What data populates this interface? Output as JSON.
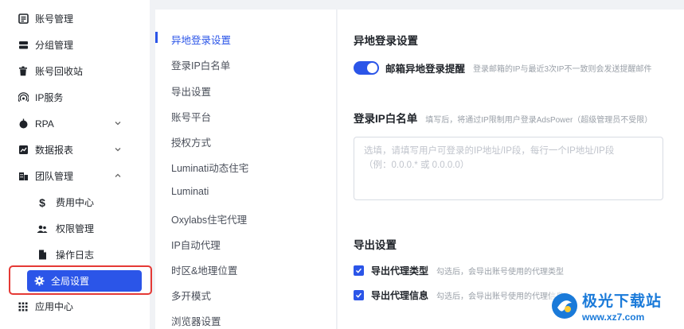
{
  "sidebar": {
    "items": [
      {
        "label": "账号管理",
        "icon": "account-list-icon"
      },
      {
        "label": "分组管理",
        "icon": "group-icon"
      },
      {
        "label": "账号回收站",
        "icon": "trash-icon"
      },
      {
        "label": "IP服务",
        "icon": "signal-icon"
      },
      {
        "label": "RPA",
        "icon": "robot-icon"
      },
      {
        "label": "数据报表",
        "icon": "chart-icon"
      },
      {
        "label": "团队管理",
        "icon": "team-icon"
      },
      {
        "label": "费用中心",
        "icon": "dollar-icon"
      },
      {
        "label": "权限管理",
        "icon": "users-icon"
      },
      {
        "label": "操作日志",
        "icon": "document-icon"
      },
      {
        "label": "全局设置",
        "icon": "gear-icon"
      },
      {
        "label": "应用中心",
        "icon": "apps-grid-icon"
      }
    ]
  },
  "settings_nav": {
    "items": [
      {
        "label": "异地登录设置"
      },
      {
        "label": "登录IP白名单"
      },
      {
        "label": "导出设置"
      },
      {
        "label": "账号平台"
      },
      {
        "label": "授权方式"
      },
      {
        "label": "Luminati动态住宅"
      },
      {
        "label": "Luminati"
      },
      {
        "label": "Oxylabs住宅代理"
      },
      {
        "label": "IP自动代理"
      },
      {
        "label": "时区&地理位置"
      },
      {
        "label": "多开模式"
      },
      {
        "label": "浏览器设置"
      }
    ]
  },
  "main": {
    "remote_login": {
      "title": "异地登录设置",
      "toggle_label": "邮箱异地登录提醒",
      "toggle_hint": "登录邮箱的IP与最近3次IP不一致则会发送提醒邮件",
      "toggle_on": true
    },
    "ip_whitelist": {
      "title": "登录IP白名单",
      "hint": "填写后，将通过IP限制用户登录AdsPower（超级管理员不受限）",
      "placeholder": "选填，请填写用户可登录的IP地址/IP段，每行一个IP地址/IP段\n（例：0.0.0.* 或 0.0.0.0）"
    },
    "export": {
      "title": "导出设置",
      "options": [
        {
          "label": "导出代理类型",
          "hint": "勾选后，会导出账号使用的代理类型",
          "checked": true
        },
        {
          "label": "导出代理信息",
          "hint": "勾选后，会导出账号使用的代理信息",
          "checked": true
        }
      ]
    }
  },
  "watermark": {
    "title": "极光下载站",
    "url": "www.xz7.com"
  },
  "colors": {
    "accent": "#2b55e8",
    "highlight_border": "#e53935",
    "hint_text": "#9aa0a8"
  }
}
